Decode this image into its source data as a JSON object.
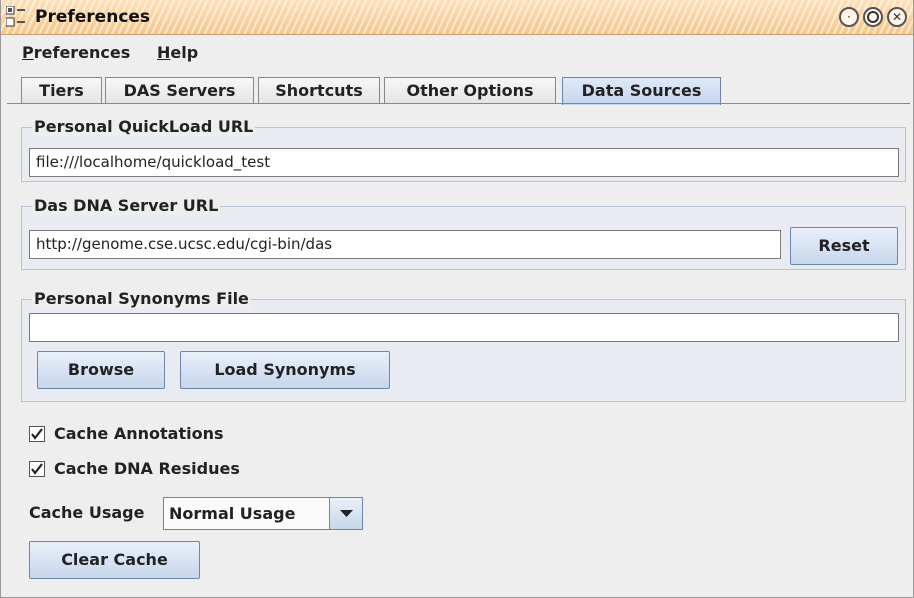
{
  "window": {
    "title": "Preferences"
  },
  "menu": [
    {
      "mnemonic": "P",
      "rest": "references"
    },
    {
      "mnemonic": "H",
      "rest": "elp"
    }
  ],
  "tabs": [
    "Tiers",
    "DAS Servers",
    "Shortcuts",
    "Other Options",
    "Data Sources"
  ],
  "active_tab": "Data Sources",
  "quickload": {
    "title": "Personal QuickLoad URL",
    "value": "file:///localhome/quickload_test"
  },
  "das_dna": {
    "title": "Das DNA Server URL",
    "value": "http://genome.cse.ucsc.edu/cgi-bin/das",
    "reset_label": "Reset"
  },
  "synonyms": {
    "title": "Personal Synonyms File",
    "value": "",
    "browse_label": "Browse",
    "load_label": "Load Synonyms"
  },
  "cache": {
    "annotations_label": "Cache Annotations",
    "annotations_checked": true,
    "dna_label": "Cache DNA Residues",
    "dna_checked": true,
    "usage_label": "Cache Usage",
    "usage_value": "Normal Usage",
    "clear_label": "Clear Cache"
  },
  "colors": {
    "titlebar": "#f3c78e",
    "button_gradient_end": "#c7d6ec",
    "active_tab": "#c4d6ef"
  },
  "icons": [
    "app-icon",
    "minimize-icon",
    "maximize-icon",
    "close-icon",
    "checkmark-icon",
    "dropdown-arrow-icon"
  ]
}
